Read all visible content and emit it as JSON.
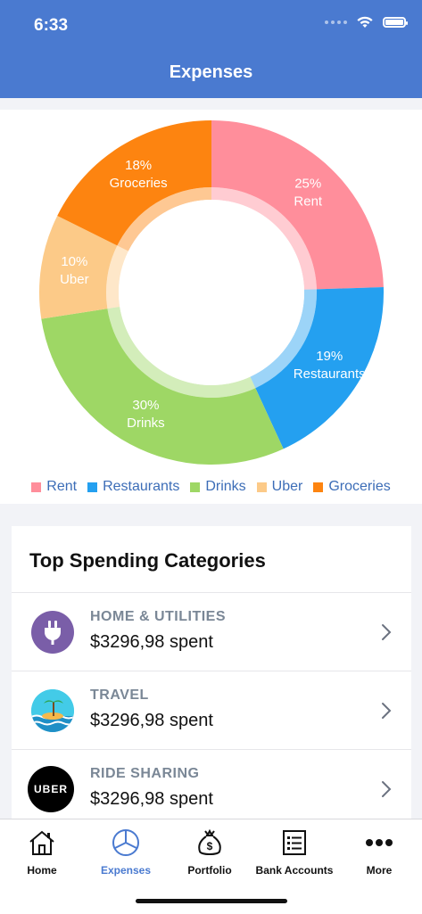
{
  "status": {
    "time": "6:33"
  },
  "header": {
    "title": "Expenses"
  },
  "colors": {
    "header": "#4a7ad0",
    "rent": "#ff8e9b",
    "restaurants": "#24a0f0",
    "drinks": "#9ed765",
    "uber": "#fcca88",
    "groceries": "#fd8410"
  },
  "chart_data": {
    "type": "pie",
    "subtype": "donut",
    "slices": [
      {
        "name": "Rent",
        "percent": 25,
        "label_pct": "25%",
        "color": "#ff8e9b"
      },
      {
        "name": "Restaurants",
        "percent": 19,
        "label_pct": "19%",
        "color": "#24a0f0"
      },
      {
        "name": "Drinks",
        "percent": 30,
        "label_pct": "30%",
        "color": "#9ed765"
      },
      {
        "name": "Uber",
        "percent": 10,
        "label_pct": "10%",
        "color": "#fcca88"
      },
      {
        "name": "Groceries",
        "percent": 18,
        "label_pct": "18%",
        "color": "#fd8410"
      }
    ],
    "legend": [
      "Rent",
      "Restaurants",
      "Drinks",
      "Uber",
      "Groceries"
    ],
    "legend_position": "bottom"
  },
  "top_spending": {
    "title": "Top Spending Categories",
    "items": [
      {
        "category": "HOME & UTILITIES",
        "amount": "$3296,98 spent",
        "icon": "plug-icon"
      },
      {
        "category": "TRAVEL",
        "amount": "$3296,98 spent",
        "icon": "beach-icon"
      },
      {
        "category": "RIDE SHARING",
        "amount": "$3296,98 spent",
        "icon": "uber-logo",
        "logo_text": "UBER"
      }
    ]
  },
  "tabs": [
    {
      "label": "Home",
      "icon": "home-icon",
      "active": false
    },
    {
      "label": "Expenses",
      "icon": "pie-chart-icon",
      "active": true
    },
    {
      "label": "Portfolio",
      "icon": "money-bag-icon",
      "active": false
    },
    {
      "label": "Bank Accounts",
      "icon": "list-icon",
      "active": false
    },
    {
      "label": "More",
      "icon": "more-icon",
      "active": false
    }
  ]
}
